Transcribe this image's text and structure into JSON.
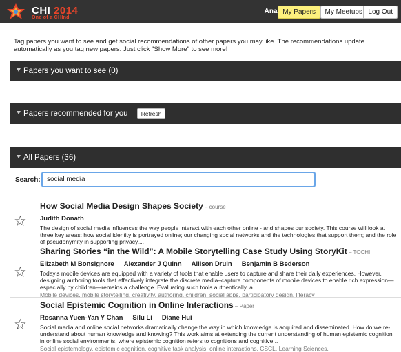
{
  "header": {
    "logo_main": "CHI",
    "logo_year": "2014",
    "logo_sub": "One of a CHInd",
    "user": "Anant",
    "buttons": {
      "my_papers": "My Papers",
      "my_meetups": "My Meetups",
      "logout": "Log Out"
    },
    "colors": {
      "bar": "#333333",
      "active_button": "#fdf07d",
      "logo_accent": "#e8452a"
    }
  },
  "intro": "Tag papers you want to see and get social recommendations of other papers you may like. The recommendations update automatically as you tag new papers. Just click \"Show More\" to see more!",
  "sections": {
    "want_to_see": "Papers you want to see (0)",
    "recommended": "Papers recommended for you",
    "refresh": "Refresh",
    "all_papers": "All Papers (36)"
  },
  "search": {
    "label": "Search:",
    "value": "social media"
  },
  "papers": [
    {
      "title": "How Social Media Design Shapes Society",
      "type": "course",
      "authors": [
        "Judith Donath"
      ],
      "abstract": "The design of social media influences the way people interact with each other online - and shapes our society. This course will look at three key areas: how social identity is portrayed online; our changing social networks and the technologies that support them; and the role of pseudonymity in supporting privacy....",
      "keywords": ""
    },
    {
      "title": "Sharing Stories “in the Wild”: A Mobile Storytelling Case Study Using StoryKit",
      "type": "TOCHI",
      "authors": [
        "Elizabeth M Bonsignore",
        "Alexander J Quinn",
        "Allison Druin",
        "Benjamin B Bederson"
      ],
      "abstract": "Today's mobile devices are equipped with a variety of tools that enable users to capture and share their daily experiences. However, designing authoring tools that effectively integrate the discrete media–capture components of mobile devices to enable rich expression—especially by children—remains a challenge. Evaluating such tools authentically, a...",
      "keywords": "Mobile devices, mobile storytelling, creativity, authoring, children, social apps, participatory design, literacy"
    },
    {
      "title": "Social Epistemic Cognition in Online Interactions",
      "type": "Paper",
      "authors": [
        "Rosanna Yuen-Yan Y Chan",
        "Silu Li",
        "Diane Hui"
      ],
      "abstract": "Social media and online social networks dramatically change the way in which knowledge is acquired and disseminated. How do we re-understand about human knowledge and knowing? This work aims at extending the current understanding of human epistemic cognition in online social environments, where epistemic cognition refers to cognitions and cognitive...",
      "keywords": "Social epistemology, epistemic cognition, cognitive task analysis, online interactions, CSCL, Learning Sciences."
    }
  ],
  "icons": {
    "star": "star-outline-icon",
    "collapse": "triangle-down-icon",
    "logo": "chi-logo-icon"
  }
}
